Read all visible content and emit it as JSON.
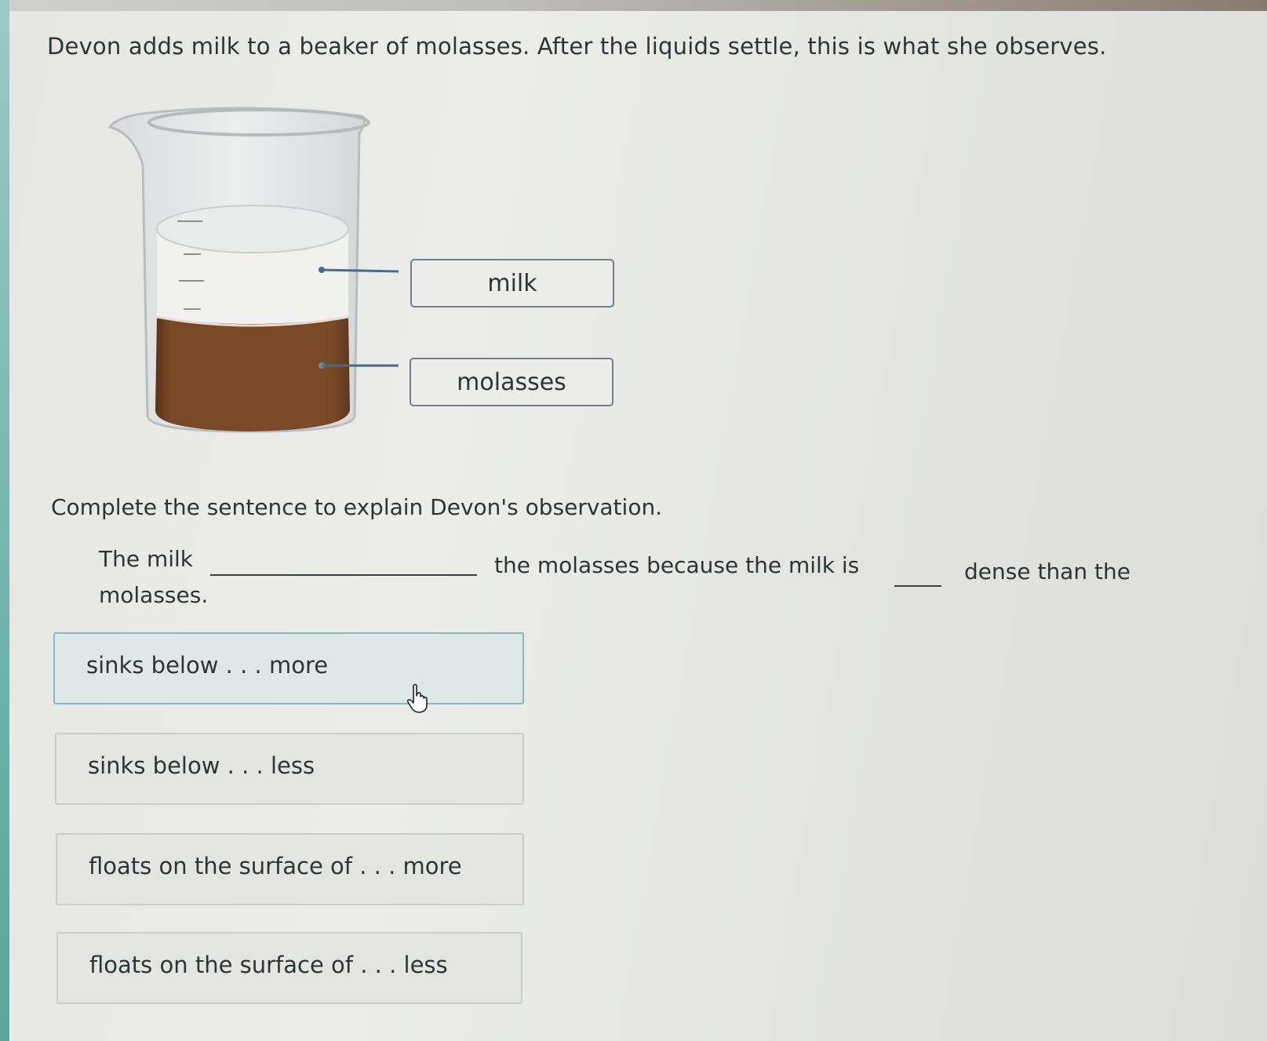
{
  "question": {
    "intro": "Devon adds milk to a beaker of molasses. After the liquids settle, this is what she observes."
  },
  "figure": {
    "labels": {
      "milk": "milk",
      "molasses": "molasses"
    },
    "colors": {
      "molasses": "#7a4a28",
      "milk": "#f2f2f0",
      "label_border": "#6f7f8b",
      "leader_line": "#4a6a88"
    }
  },
  "prompt": {
    "instruction": "Complete the sentence to explain Devon's observation.",
    "sentence": {
      "part1": "The milk",
      "part2": "the molasses because the milk is",
      "part3": "dense than the",
      "part4": "molasses."
    }
  },
  "choices": [
    {
      "label": "sinks below . . . more",
      "hovered": true
    },
    {
      "label": "sinks below . . . less",
      "hovered": false
    },
    {
      "label": "floats on the surface of . . . more",
      "hovered": false
    },
    {
      "label": "floats on the surface of . . . less",
      "hovered": false
    }
  ],
  "cursor": {
    "type": "pointer-hand-icon"
  }
}
